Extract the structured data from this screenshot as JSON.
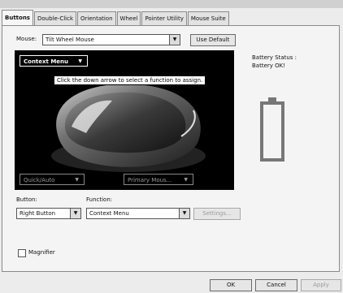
{
  "tabs": [
    "Buttons",
    "Double-Click",
    "Orientation",
    "Wheel",
    "Pointer Utility",
    "Mouse Suite"
  ],
  "mouse": {
    "label": "Mouse:",
    "value": "Tilt Wheel Mouse",
    "use_default": "Use Default"
  },
  "canvas": {
    "context_menu": "Context Menu",
    "tooltip": "Click the down arrow to select a function to assign.",
    "left_combo": "Quick/Auto",
    "right_combo": "Primary Mous..."
  },
  "battery": {
    "line1": "Battery Status :",
    "line2": "Battery OK!"
  },
  "button_field": {
    "label": "Button:",
    "value": "Right Button"
  },
  "function_field": {
    "label": "Function:",
    "value": "Context Menu"
  },
  "settings_label": "Settings...",
  "magnifier_label": "Magnifier",
  "footer": {
    "ok": "OK",
    "cancel": "Cancel",
    "apply": "Apply"
  }
}
